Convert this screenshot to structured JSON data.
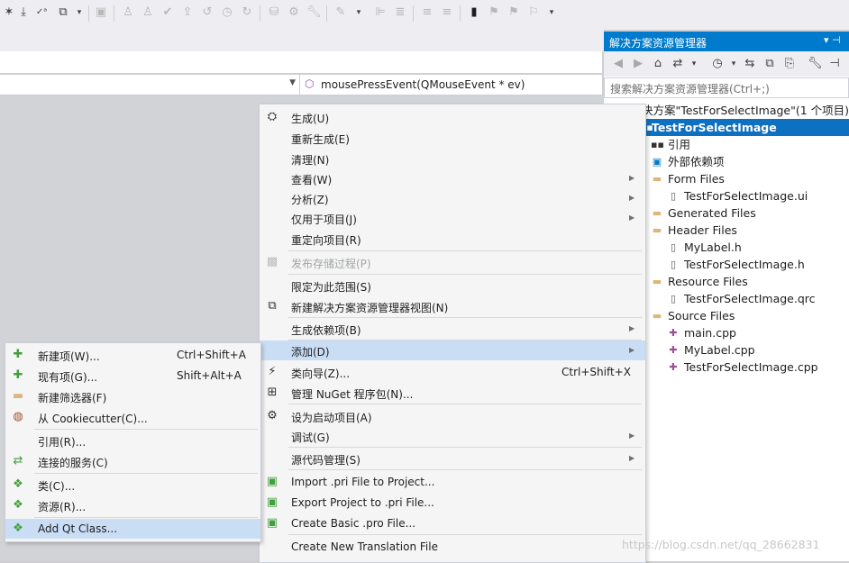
{
  "toolbar": {
    "icons": [
      "new-item-icon",
      "add-item-icon",
      "spell-check-icon",
      "navigate-icon",
      "compare-icon",
      "build-icon",
      "clean-icon",
      "check-icon",
      "publish-icon",
      "undo-icon",
      "history-icon",
      "refresh-icon",
      "database-icon",
      "settings-icon",
      "wrench-icon",
      "code-icon",
      "align-icon",
      "format-icon",
      "comment-icon",
      "uncomment-icon",
      "bookmark-icon",
      "prev-bookmark-icon",
      "next-bookmark-icon",
      "clear-bookmark-icon"
    ]
  },
  "editor": {
    "member_function": "mousePressEvent(QMouseEvent * ev)"
  },
  "solution_explorer": {
    "title": "解决方案资源管理器",
    "search_placeholder": "搜索解决方案资源管理器(Ctrl+;)",
    "tree": [
      {
        "label": "决方案\"TestForSelectImage\"(1 个项目)",
        "icon": "solution-icon"
      },
      {
        "label": "TestForSelectImage",
        "icon": "project-icon",
        "selected": true
      },
      {
        "label": "引用",
        "icon": "references-icon"
      },
      {
        "label": "外部依赖项",
        "icon": "external-deps-icon"
      },
      {
        "label": "Form Files",
        "icon": "folder-icon"
      },
      {
        "label": "TestForSelectImage.ui",
        "icon": "file-icon"
      },
      {
        "label": "Generated Files",
        "icon": "folder-icon"
      },
      {
        "label": "Header Files",
        "icon": "folder-icon"
      },
      {
        "label": "MyLabel.h",
        "icon": "header-file-icon"
      },
      {
        "label": "TestForSelectImage.h",
        "icon": "header-file-icon"
      },
      {
        "label": "Resource Files",
        "icon": "folder-icon"
      },
      {
        "label": "TestForSelectImage.qrc",
        "icon": "file-icon"
      },
      {
        "label": "Source Files",
        "icon": "folder-icon"
      },
      {
        "label": "main.cpp",
        "icon": "cpp-file-icon"
      },
      {
        "label": "MyLabel.cpp",
        "icon": "cpp-file-icon"
      },
      {
        "label": "TestForSelectImage.cpp",
        "icon": "cpp-file-icon"
      }
    ]
  },
  "context_menu": {
    "items": [
      {
        "label": "生成(U)",
        "icon": "build-icon"
      },
      {
        "label": "重新生成(E)"
      },
      {
        "label": "清理(N)"
      },
      {
        "label": "查看(W)",
        "submenu": true
      },
      {
        "label": "分析(Z)",
        "submenu": true
      },
      {
        "label": "仅用于项目(J)",
        "submenu": true
      },
      {
        "label": "重定向项目(R)"
      },
      {
        "label": "发布存储过程(P)",
        "icon": "publish-icon",
        "disabled": true
      },
      {
        "label": "限定为此范围(S)"
      },
      {
        "label": "新建解决方案资源管理器视图(N)",
        "icon": "new-view-icon"
      },
      {
        "label": "生成依赖项(B)",
        "submenu": true
      },
      {
        "label": "添加(D)",
        "submenu": true,
        "highlighted": true
      },
      {
        "label": "类向导(Z)...",
        "icon": "class-wizard-icon",
        "shortcut": "Ctrl+Shift+X"
      },
      {
        "label": "管理 NuGet 程序包(N)...",
        "icon": "nuget-icon"
      },
      {
        "label": "设为启动项目(A)",
        "icon": "gear-icon"
      },
      {
        "label": "调试(G)",
        "submenu": true
      },
      {
        "label": "源代码管理(S)",
        "submenu": true
      },
      {
        "label": "Import .pri File to Project...",
        "icon": "qt-import-icon"
      },
      {
        "label": "Export Project to .pri File...",
        "icon": "qt-export-icon"
      },
      {
        "label": "Create Basic .pro File...",
        "icon": "qt-pro-icon"
      },
      {
        "label": "Create New Translation File"
      }
    ]
  },
  "add_submenu": {
    "items": [
      {
        "label": "新建项(W)...",
        "shortcut": "Ctrl+Shift+A",
        "icon": "new-item-icon"
      },
      {
        "label": "现有项(G)...",
        "shortcut": "Shift+Alt+A",
        "icon": "existing-item-icon"
      },
      {
        "label": "新建筛选器(F)",
        "icon": "new-filter-icon"
      },
      {
        "label": "从 Cookiecutter(C)...",
        "icon": "cookiecutter-icon"
      },
      {
        "label": "引用(R)..."
      },
      {
        "label": "连接的服务(C)",
        "icon": "connected-service-icon"
      },
      {
        "label": "类(C)...",
        "icon": "class-icon"
      },
      {
        "label": "资源(R)...",
        "icon": "resource-icon"
      },
      {
        "label": "Add Qt Class...",
        "icon": "qt-class-icon",
        "highlighted": true
      }
    ]
  },
  "watermark": "https://blog.csdn.net/qq_28662831",
  "colors": {
    "accent": "#007acc",
    "highlight": "#c9def5",
    "selected_row": "#0e70c0"
  }
}
